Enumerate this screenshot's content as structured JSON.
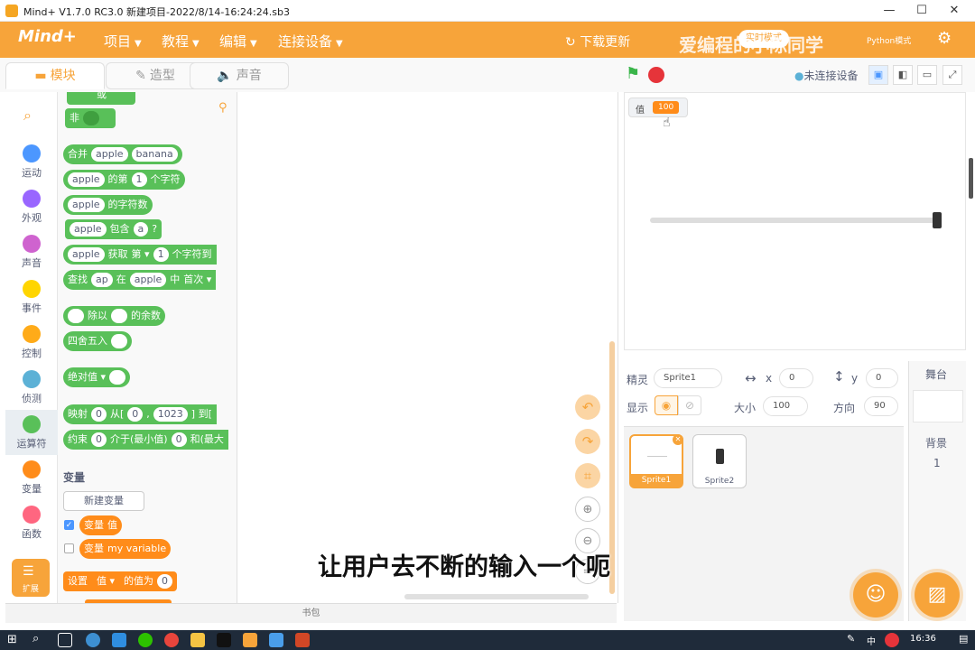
{
  "window": {
    "title": "Mind+ V1.7.0 RC3.0   新建项目-2022/8/14-16:24:24.sb3",
    "minimize": "—",
    "maximize": "☐",
    "close": "✕"
  },
  "menu": {
    "logo": "Mind+",
    "items": [
      "项目",
      "教程",
      "编辑",
      "连接设备"
    ],
    "download_update": "下载更新",
    "mode_label": "实时模式",
    "python_label": "Python模式",
    "watermark": "爱编程的小陈同学"
  },
  "tabs": {
    "blocks": "模块",
    "costumes": "造型",
    "sounds": "声音"
  },
  "categories": [
    {
      "label": "运动",
      "color": "#4c97ff"
    },
    {
      "label": "外观",
      "color": "#9966ff"
    },
    {
      "label": "声音",
      "color": "#cf63cf"
    },
    {
      "label": "事件",
      "color": "#ffd500"
    },
    {
      "label": "控制",
      "color": "#ffab19"
    },
    {
      "label": "侦测",
      "color": "#5cb1d6"
    },
    {
      "label": "运算符",
      "color": "#59c059"
    },
    {
      "label": "变量",
      "color": "#ff8c1a"
    },
    {
      "label": "函数",
      "color": "#ff6680"
    }
  ],
  "extensions_label": "扩展",
  "palette": {
    "or": "或",
    "not": "非",
    "join": {
      "label": "合并",
      "a": "apple",
      "b": "banana"
    },
    "letter_of": {
      "a": "apple",
      "mid": "的第",
      "n": "1",
      "tail": "个字符"
    },
    "length_of": {
      "a": "apple",
      "tail": "的字符数"
    },
    "contains": {
      "a": "apple",
      "mid": "包含",
      "b": "a",
      "tail": "?"
    },
    "get": {
      "a": "apple",
      "mid": "获取",
      "dd": "第",
      "n": "1",
      "tail": "个字符到"
    },
    "find": {
      "label": "查找",
      "a": "ap",
      "mid": "在",
      "b": "apple",
      "mid2": "中",
      "dd": "首次"
    },
    "mod": {
      "mid": "除以",
      "tail": "的余数"
    },
    "round": {
      "label": "四舍五入"
    },
    "abs": {
      "dd": "绝对值"
    },
    "map": {
      "label": "映射",
      "a": "0",
      "mid": "从[",
      "b": "0",
      "c": "1023",
      "tail": "] 到["
    },
    "constrain": {
      "label": "约束",
      "a": "0",
      "mid": "介于(最小值)",
      "b": "0",
      "tail": "和(最大"
    },
    "variables_title": "变量",
    "new_variable": "新建变量",
    "var1": {
      "prefix": "变量",
      "name": "值"
    },
    "var2": {
      "prefix": "变量",
      "name": "my variable"
    },
    "set": {
      "label": "设置",
      "dd": "值",
      "mid": "的值为",
      "v": "0"
    }
  },
  "subtitle": "让用户去不断的输入一个呃",
  "bag_label": "书包",
  "stage": {
    "device_status": "未连接设备",
    "monitor_label": "值",
    "monitor_value": "100",
    "slider_value": 100
  },
  "sprite_info": {
    "sprite_label": "精灵",
    "sprite_name": "Sprite1",
    "x_label": "x",
    "x_value": "0",
    "y_label": "y",
    "y_value": "0",
    "show_label": "显示",
    "size_label": "大小",
    "size_value": "100",
    "direction_label": "方向",
    "direction_value": "90"
  },
  "sprites": [
    "Sprite1",
    "Sprite2"
  ],
  "stage_panel": {
    "title": "舞台",
    "backdrop_label": "背景",
    "backdrop_count": "1"
  },
  "taskbar": {
    "time": "16:36",
    "ime": "中"
  }
}
